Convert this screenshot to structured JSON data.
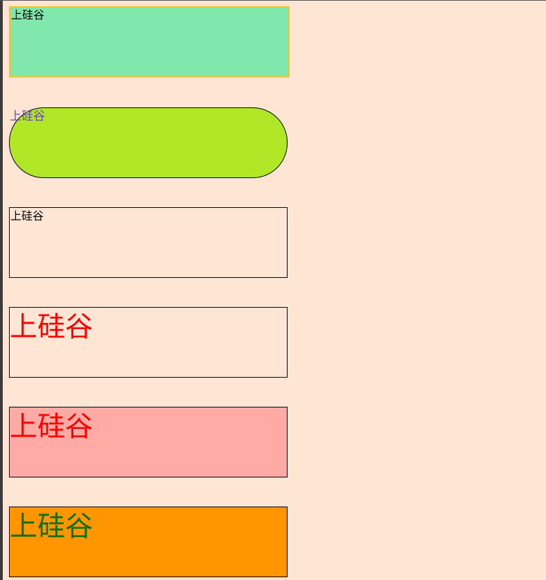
{
  "boxes": [
    {
      "text": "上硅谷",
      "background": "#80e8ac",
      "border": "#f4c430",
      "text_color": "#000000"
    },
    {
      "text": "上硅谷",
      "background": "#b0e827",
      "border": "#000000",
      "text_color": "#6a4aa0"
    },
    {
      "text": "上硅谷",
      "background": "transparent",
      "border": "#000000",
      "text_color": "#000000"
    },
    {
      "text": "上硅谷",
      "background": "transparent",
      "border": "#000000",
      "text_color": "#ff0000"
    },
    {
      "text": "上硅谷",
      "background": "#ffaaa5",
      "border": "#000000",
      "text_color": "#ff0000"
    },
    {
      "text": "上硅谷",
      "background": "#ff9500",
      "border": "#000000",
      "text_color": "#0f6f14"
    }
  ],
  "page_background": "#ffe6d4"
}
